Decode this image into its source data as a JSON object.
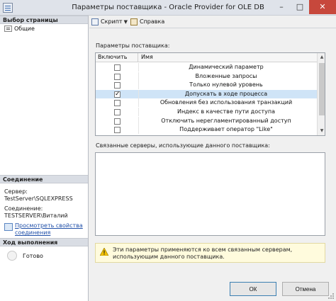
{
  "window": {
    "title": "Параметры поставщика - Oracle Provider for OLE DB",
    "controls": {
      "minimize": "–",
      "maximize": "□",
      "close": "✕"
    }
  },
  "left_panel": {
    "select_page_header": "Выбор страницы",
    "pages": [
      {
        "label": "Общие",
        "icon": "page-icon"
      }
    ],
    "connection": {
      "header": "Соединение",
      "server_label": "Сервер:",
      "server_value": "TestServer\\SQLEXPRESS",
      "conn_label": "Соединение:",
      "conn_value": "TESTSERVER\\Виталий",
      "link_text": "Просмотреть свойства соединения"
    },
    "progress": {
      "header": "Ход выполнения",
      "status": "Готово"
    }
  },
  "toolbar": {
    "script_label": "Скрипт",
    "help_label": "Справка"
  },
  "params": {
    "label": "Параметры поставщика:",
    "col_enable": "Включить",
    "col_name": "Имя",
    "rows": [
      {
        "name": "Динамический параметр",
        "checked": false
      },
      {
        "name": "Вложенные запросы",
        "checked": false
      },
      {
        "name": "Только нулевой уровень",
        "checked": false
      },
      {
        "name": "Допускать в ходе процесса",
        "checked": true
      },
      {
        "name": "Обновления без использования транзакций",
        "checked": false
      },
      {
        "name": "Индекс в качестве пути доступа",
        "checked": false
      },
      {
        "name": "Отключить нерегламентированный доступ",
        "checked": false
      },
      {
        "name": "Поддерживает оператор \"Like\"",
        "checked": false
      }
    ]
  },
  "linked_servers": {
    "label": "Связанные серверы, использующие данного поставщика:"
  },
  "warning": {
    "text": "Эти параметры применяются ко всем связанным серверам, использующим данного поставщика."
  },
  "buttons": {
    "ok": "ОК",
    "cancel": "Отмена"
  },
  "colors": {
    "selected_row": "#cfe4f7",
    "link": "#1f4fa8",
    "warning_bg": "#fffbdd"
  }
}
